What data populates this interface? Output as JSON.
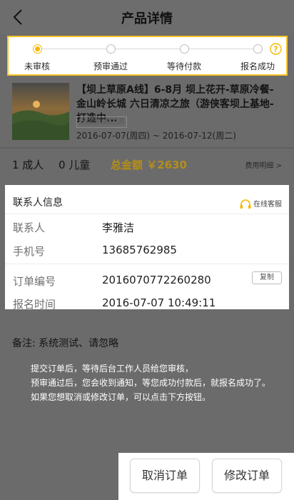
{
  "header": {
    "title": "产品详情",
    "back_icon": "chevron-left-icon"
  },
  "progress": {
    "steps": [
      "未审核",
      "预审通过",
      "等待付款",
      "报名成功"
    ],
    "active_index": 0,
    "accent_color": "#f5b800",
    "help_icon": "question-circle-icon"
  },
  "product": {
    "title": "【坝上草原A线】6-8月 坝上花开-草原冷餐-金山岭长城 六日清凉之旅（游侠客坝上基地-打造中...",
    "tag": "深度游|跟团游",
    "dates": "2016-07-07(周四) ~ 2016-07-12(周二)"
  },
  "summary": {
    "adults": "1 成人",
    "children": "0 儿童",
    "total": "总金额 ￥2630",
    "fee_details": "费用明细 >"
  },
  "contact": {
    "title": "联系人信息",
    "service": "在线客服",
    "rows": [
      {
        "label": "联系人",
        "value": "李雅洁"
      },
      {
        "label": "手机号",
        "value": "13685762985"
      },
      {
        "label": "订单编号",
        "value": "2016070772260280"
      },
      {
        "label": "报名时间",
        "value": "2016-07-07 10:49:11"
      }
    ],
    "copy_label": "复制"
  },
  "remark": "备注:  系统测试、请忽略",
  "notice": [
    "提交订单后，等待后台工作人员给您审核，",
    "预审通过后，您会收到通知，等您成功付款后，就报名成功了。",
    "如果您想取消或修改订单，可以点击下方按钮。"
  ],
  "actions": {
    "cancel": "取消订单",
    "modify": "修改订单"
  }
}
